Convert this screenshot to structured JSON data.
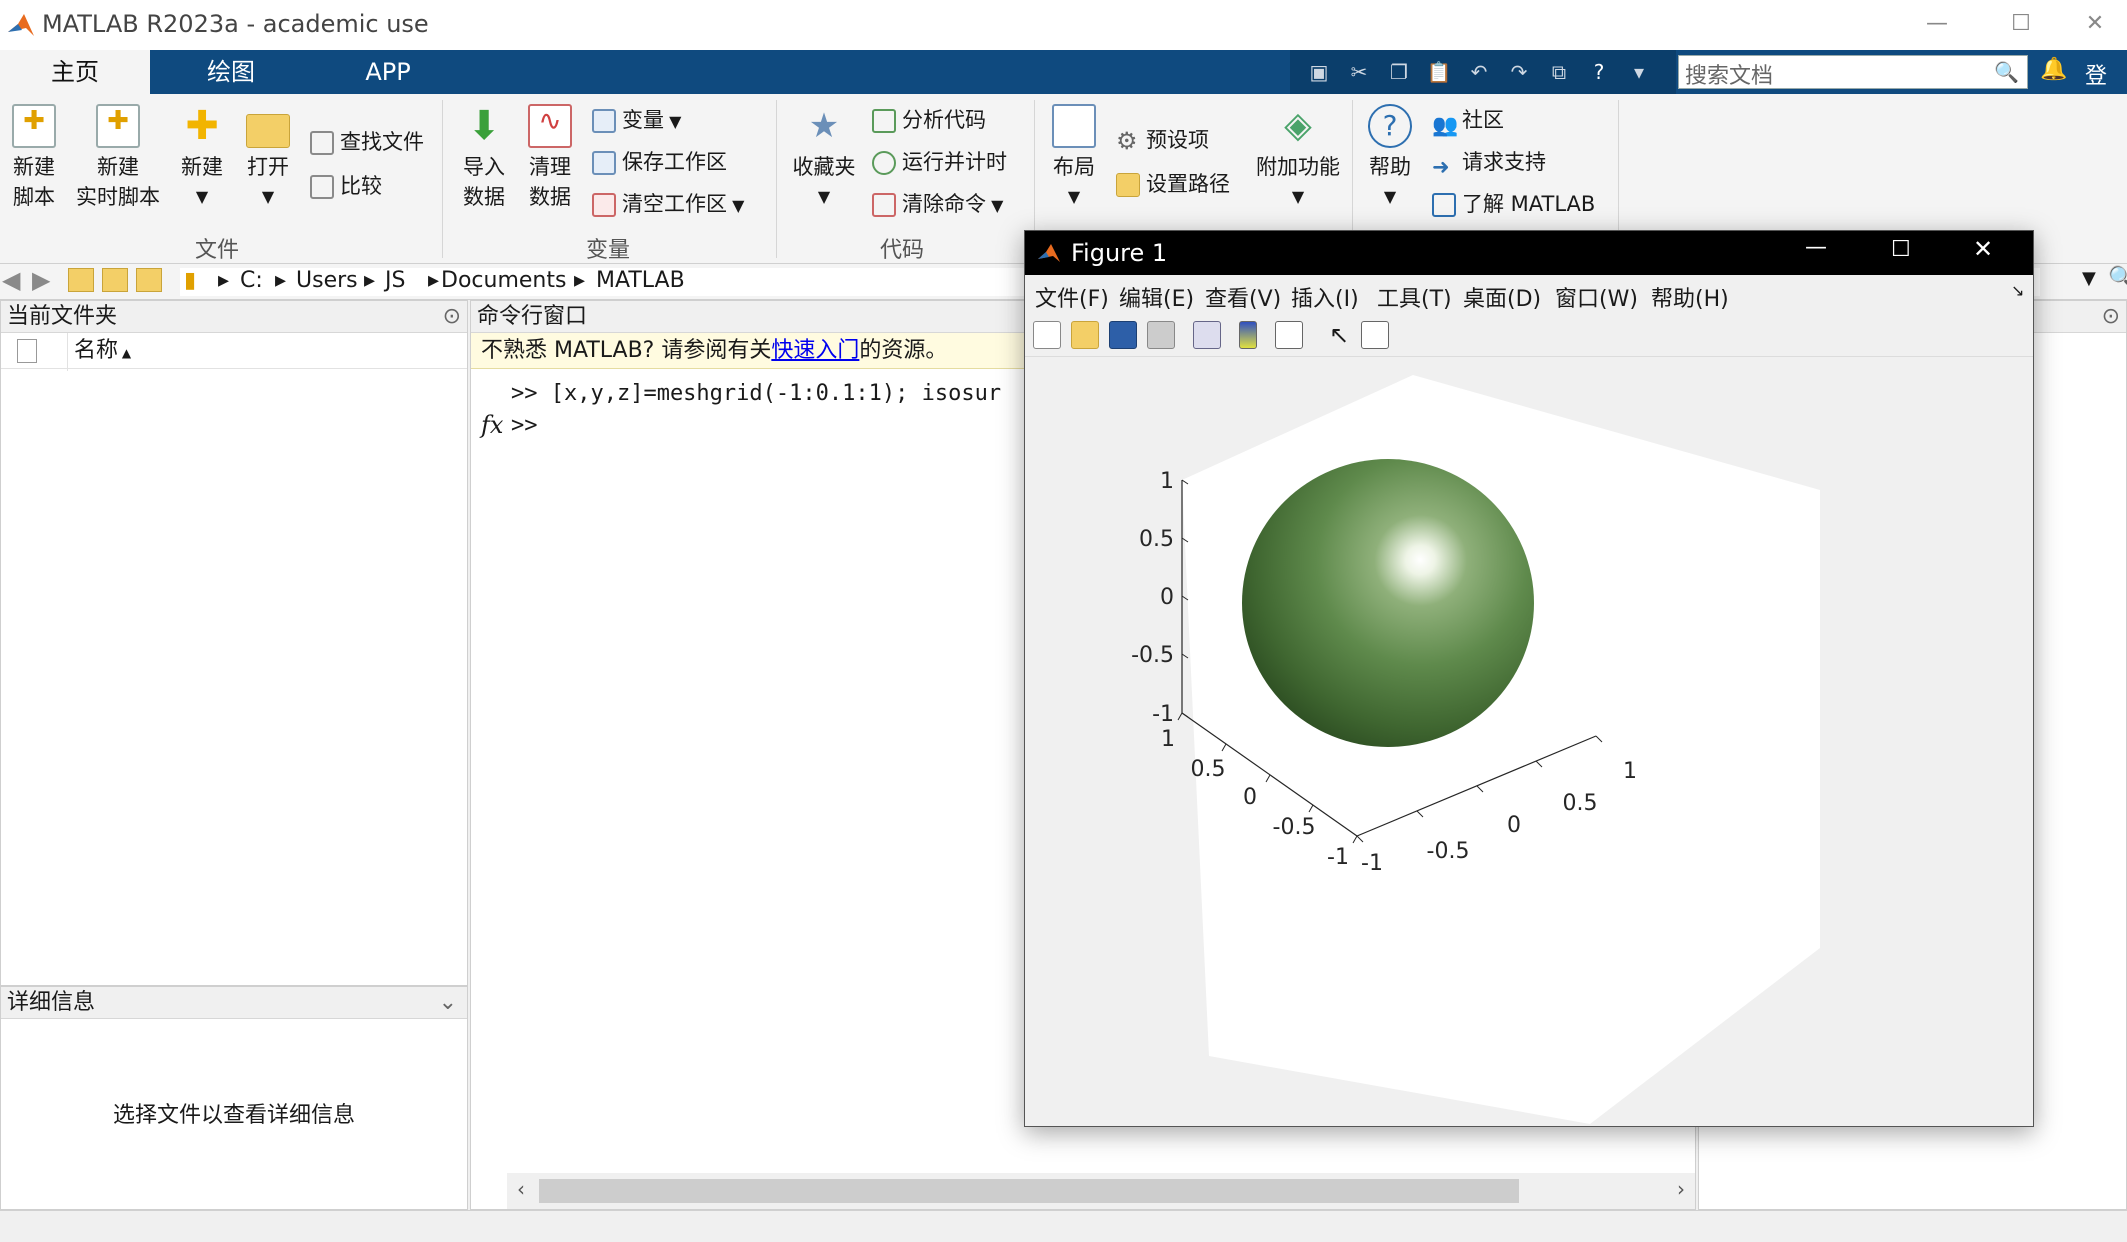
{
  "window": {
    "title": "MATLAB R2023a - academic use"
  },
  "tabs": [
    {
      "label": "主页"
    },
    {
      "label": "绘图"
    },
    {
      "label": "APP"
    }
  ],
  "search": {
    "placeholder": "搜索文档"
  },
  "account": {
    "login_label": "登录"
  },
  "ribbon": {
    "file": {
      "group_label": "文件",
      "new_script": "新建\n脚本",
      "new_live_script": "新建\n实时脚本",
      "new": "新建",
      "open": "打开",
      "find_files": "查找文件",
      "compare": "比较"
    },
    "variable": {
      "group_label": "变量",
      "import_data": "导入\n数据",
      "clean_data": "清理\n数据",
      "variable": "变量",
      "save_workspace": "保存工作区",
      "clear_workspace": "清空工作区"
    },
    "code": {
      "group_label": "代码",
      "favorites": "收藏夹",
      "analyze_code": "分析代码",
      "run_and_time": "运行并计时",
      "clear_commands": "清除命令"
    },
    "environment": {
      "layout": "布局",
      "preferences": "预设项",
      "set_path": "设置路径",
      "add_ons": "附加功能"
    },
    "resources": {
      "help": "帮助",
      "community": "社区",
      "request_support": "请求支持",
      "learn_matlab": "了解 MATLAB"
    }
  },
  "address": {
    "path": [
      "C:",
      "Users",
      "JS",
      "Documents",
      "MATLAB"
    ]
  },
  "current_folder": {
    "title": "当前文件夹",
    "column_name": "名称",
    "details_title": "详细信息",
    "details_placeholder": "选择文件以查看详细信息"
  },
  "command_window": {
    "title": "命令行窗口",
    "notice_prefix": "不熟悉 MATLAB? 请参阅有关",
    "notice_link": "快速入门",
    "notice_suffix": "的资源。",
    "history_line": ">> [x,y,z]=meshgrid(-1:0.1:1); isosur",
    "prompt": ">>",
    "fx_label": "fx"
  },
  "figure": {
    "title": "Figure 1",
    "menu": [
      "文件(F)",
      "编辑(E)",
      "查看(V)",
      "插入(I)",
      "工具(T)",
      "桌面(D)",
      "窗口(W)",
      "帮助(H)"
    ],
    "colors": {
      "sphere": "#567f45",
      "highlight": "#ffffff"
    },
    "axes": {
      "z_ticks": [
        "1",
        "0.5",
        "0",
        "-0.5",
        "-1"
      ],
      "x_ticks": [
        "1",
        "0.5",
        "0",
        "-0.5",
        "-1"
      ],
      "y_ticks": [
        "1",
        "0.5",
        "0",
        "-0.5",
        "-1"
      ]
    }
  }
}
